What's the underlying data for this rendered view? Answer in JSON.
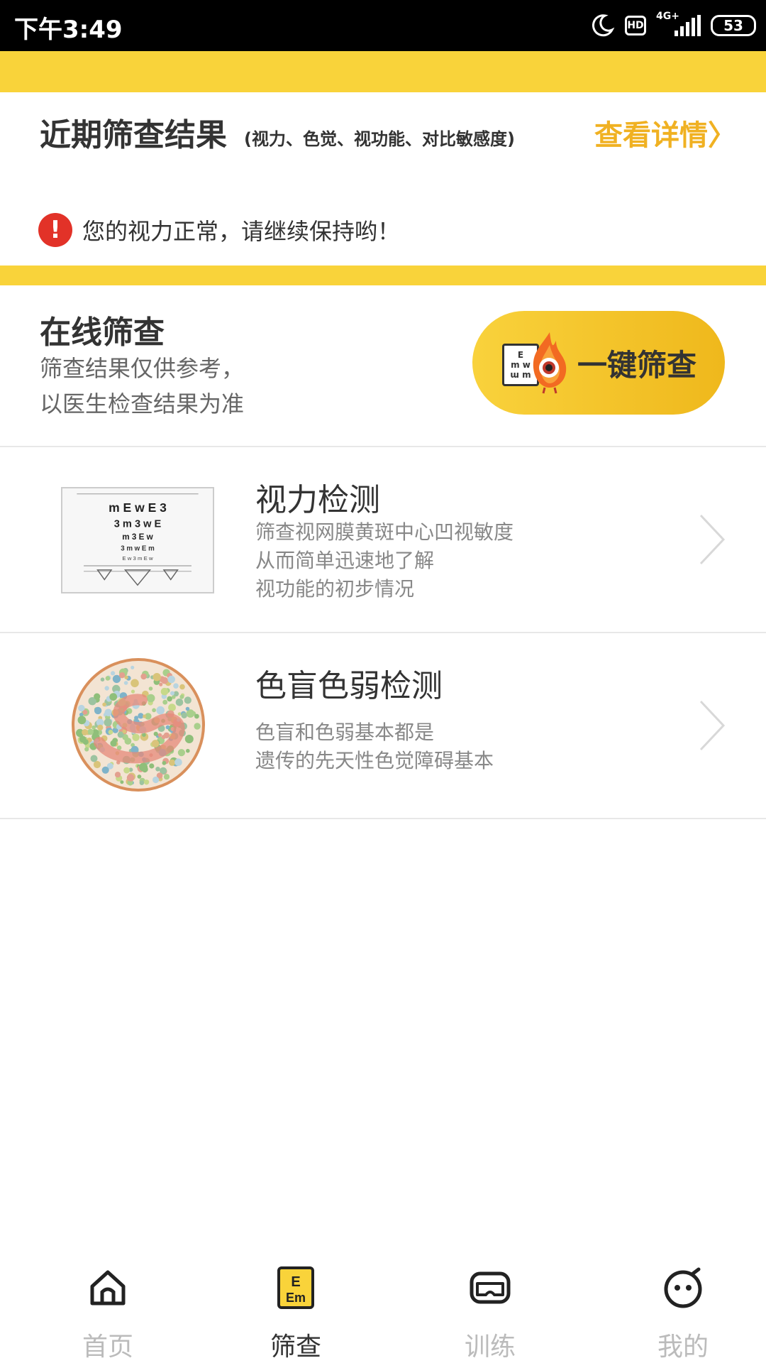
{
  "status_bar": {
    "time": "下午3:49",
    "hd": "HD",
    "network": "4G+",
    "battery": "53"
  },
  "recent": {
    "title": "近期筛查结果",
    "subtitle": "(视力、色觉、视功能、对比敏感度)",
    "view_detail": "查看详情〉",
    "alert_text": "您的视力正常，请继续保持哟！"
  },
  "online": {
    "title": "在线筛查",
    "desc_line1": "筛查结果仅供参考，",
    "desc_line2": "以医生检查结果为准",
    "quick_button": "一键筛查"
  },
  "tests": [
    {
      "title": "视力检测",
      "lines": [
        "筛查视网膜黄斑中心凹视敏度",
        "从而简单迅速地了解",
        "视功能的初步情况"
      ],
      "icon": "eye-chart-image"
    },
    {
      "title": "色盲色弱检测",
      "lines": [
        "色盲和色弱基本都是",
        "遗传的先天性色觉障碍基本"
      ],
      "icon": "ishihara-plate-image"
    }
  ],
  "tabbar": [
    {
      "label": "首页",
      "icon": "home-icon",
      "active": false
    },
    {
      "label": "筛查",
      "icon": "eye-chart-icon",
      "active": true
    },
    {
      "label": "训练",
      "icon": "vr-goggles-icon",
      "active": false
    },
    {
      "label": "我的",
      "icon": "face-icon",
      "active": false
    }
  ],
  "colors": {
    "accent_yellow": "#f9d33a",
    "link_orange": "#f0b122",
    "alert_red": "#e23228"
  }
}
